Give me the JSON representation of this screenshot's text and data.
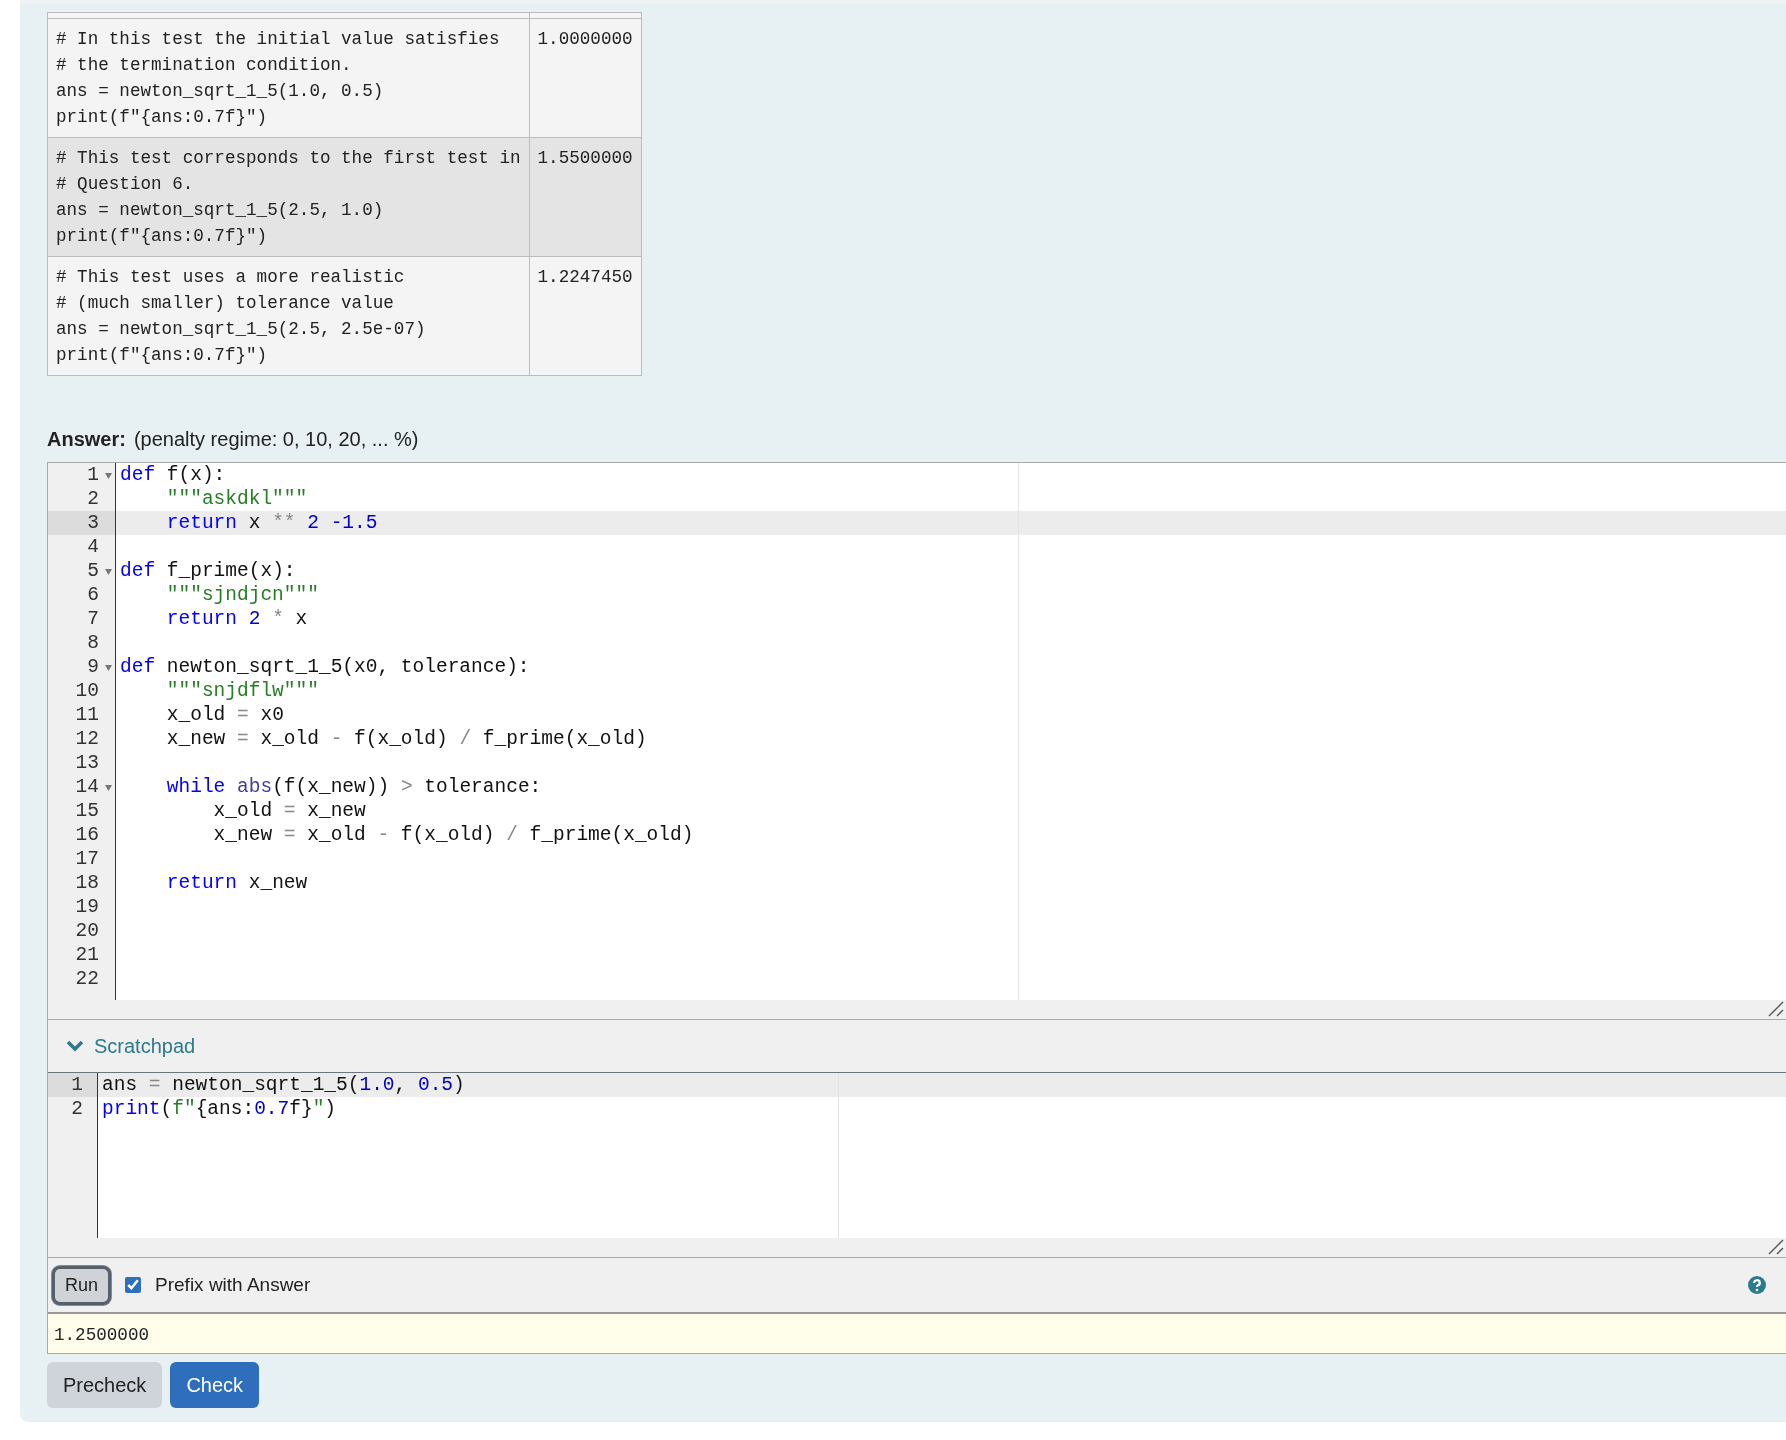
{
  "tests": [
    {
      "code": "# In this test the initial value satisfies\n# the termination condition.\nans = newton_sqrt_1_5(1.0, 0.5)\nprint(f\"{ans:0.7f}\")",
      "result": "1.0000000"
    },
    {
      "code": "# This test corresponds to the first test in\n# Question 6.\nans = newton_sqrt_1_5(2.5, 1.0)\nprint(f\"{ans:0.7f}\")",
      "result": "1.5500000"
    },
    {
      "code": "# This test uses a more realistic\n# (much smaller) tolerance value\nans = newton_sqrt_1_5(2.5, 2.5e-07)\nprint(f\"{ans:0.7f}\")",
      "result": "1.2247450"
    }
  ],
  "answer": {
    "label": "Answer:",
    "penalty": "(penalty regime: 0, 10, 20, ... %)"
  },
  "editor": {
    "lines": [
      {
        "number": "1",
        "fold": true,
        "active": false,
        "tokens": [
          {
            "kind": "kw",
            "text": "def"
          },
          {
            "kind": "plain",
            "text": " f(x):"
          }
        ]
      },
      {
        "number": "2",
        "fold": false,
        "active": false,
        "tokens": [
          {
            "kind": "str",
            "text": "    \"\"\"askdkl\"\"\""
          }
        ]
      },
      {
        "number": "3",
        "fold": false,
        "active": true,
        "tokens": [
          {
            "kind": "kw",
            "text": "    return"
          },
          {
            "kind": "plain",
            "text": " x "
          },
          {
            "kind": "op",
            "text": "**"
          },
          {
            "kind": "num",
            "text": " 2"
          },
          {
            "kind": "num",
            "text": " -1.5"
          }
        ]
      },
      {
        "number": "4",
        "fold": false,
        "active": false
      },
      {
        "number": "5",
        "fold": true,
        "active": false,
        "tokens": [
          {
            "kind": "kw",
            "text": "def"
          },
          {
            "kind": "plain",
            "text": " f_prime(x):"
          }
        ]
      },
      {
        "number": "6",
        "fold": false,
        "active": false,
        "tokens": [
          {
            "kind": "str",
            "text": "    \"\"\"sjndjcn\"\"\""
          }
        ]
      },
      {
        "number": "7",
        "fold": false,
        "active": false,
        "tokens": [
          {
            "kind": "kw",
            "text": "    return"
          },
          {
            "kind": "num",
            "text": " 2"
          },
          {
            "kind": "op",
            "text": " *"
          },
          {
            "kind": "plain",
            "text": " x"
          }
        ]
      },
      {
        "number": "8",
        "fold": false,
        "active": false
      },
      {
        "number": "9",
        "fold": true,
        "active": false,
        "tokens": [
          {
            "kind": "kw",
            "text": "def"
          },
          {
            "kind": "plain",
            "text": " newton_sqrt_1_5(x0, tolerance):"
          }
        ]
      },
      {
        "number": "10",
        "fold": false,
        "active": false,
        "tokens": [
          {
            "kind": "str",
            "text": "    \"\"\"snjdflw\"\"\""
          }
        ]
      },
      {
        "number": "11",
        "fold": false,
        "active": false,
        "tokens": [
          {
            "kind": "plain",
            "text": "    x_old "
          },
          {
            "kind": "op",
            "text": "="
          },
          {
            "kind": "plain",
            "text": " x0"
          }
        ]
      },
      {
        "number": "12",
        "fold": false,
        "active": false,
        "tokens": [
          {
            "kind": "plain",
            "text": "    x_new "
          },
          {
            "kind": "op",
            "text": "="
          },
          {
            "kind": "plain",
            "text": " x_old "
          },
          {
            "kind": "op",
            "text": "-"
          },
          {
            "kind": "plain",
            "text": " f(x_old) "
          },
          {
            "kind": "op",
            "text": "/"
          },
          {
            "kind": "plain",
            "text": " f_prime(x_old)"
          }
        ]
      },
      {
        "number": "13",
        "fold": false,
        "active": false
      },
      {
        "number": "14",
        "fold": true,
        "active": false,
        "tokens": [
          {
            "kind": "kw",
            "text": "    while"
          },
          {
            "kind": "builtin",
            "text": " abs"
          },
          {
            "kind": "plain",
            "text": "(f(x_new)) "
          },
          {
            "kind": "op",
            "text": ">"
          },
          {
            "kind": "plain",
            "text": " tolerance:"
          }
        ]
      },
      {
        "number": "15",
        "fold": false,
        "active": false,
        "tokens": [
          {
            "kind": "plain",
            "text": "        x_old "
          },
          {
            "kind": "op",
            "text": "="
          },
          {
            "kind": "plain",
            "text": " x_new"
          }
        ]
      },
      {
        "number": "16",
        "fold": false,
        "active": false,
        "tokens": [
          {
            "kind": "plain",
            "text": "        x_new "
          },
          {
            "kind": "op",
            "text": "="
          },
          {
            "kind": "plain",
            "text": " x_old "
          },
          {
            "kind": "op",
            "text": "-"
          },
          {
            "kind": "plain",
            "text": " f(x_old) "
          },
          {
            "kind": "op",
            "text": "/"
          },
          {
            "kind": "plain",
            "text": " f_prime(x_old)"
          }
        ]
      },
      {
        "number": "17",
        "fold": false,
        "active": false
      },
      {
        "number": "18",
        "fold": false,
        "active": false,
        "tokens": [
          {
            "kind": "kw",
            "text": "    return"
          },
          {
            "kind": "plain",
            "text": " x_new"
          }
        ]
      },
      {
        "number": "19",
        "fold": false,
        "active": false
      },
      {
        "number": "20",
        "fold": false,
        "active": false
      },
      {
        "number": "21",
        "fold": false,
        "active": false
      },
      {
        "number": "22",
        "fold": false,
        "active": false
      }
    ]
  },
  "scratchpad": {
    "title": "Scratchpad",
    "expanded": true,
    "lines": [
      {
        "number": "1",
        "fold": false,
        "active": true,
        "tokens": [
          {
            "kind": "plain",
            "text": "ans "
          },
          {
            "kind": "op",
            "text": "="
          },
          {
            "kind": "plain",
            "text": " newton_sqrt_1_5("
          },
          {
            "kind": "num",
            "text": "1.0"
          },
          {
            "kind": "plain",
            "text": ","
          },
          {
            "kind": "num",
            "text": " 0.5"
          },
          {
            "kind": "plain",
            "text": ")"
          }
        ]
      },
      {
        "number": "2",
        "fold": false,
        "active": false,
        "tokens": [
          {
            "kind": "kw",
            "text": "print"
          },
          {
            "kind": "plain",
            "text": "("
          },
          {
            "kind": "str",
            "text": "f\""
          },
          {
            "kind": "plain",
            "text": "{ans:"
          },
          {
            "kind": "num",
            "text": "0.7"
          },
          {
            "kind": "plain",
            "text": "f}"
          },
          {
            "kind": "str",
            "text": "\""
          },
          {
            "kind": "plain",
            "text": ")"
          }
        ]
      }
    ],
    "run_button": "Run",
    "prefix": {
      "label": "Prefix with Answer",
      "checked": true
    },
    "output": "1.2500000"
  },
  "buttons": [
    {
      "label": "Precheck",
      "kind": "secondary"
    },
    {
      "label": "Check",
      "kind": "primary"
    }
  ]
}
